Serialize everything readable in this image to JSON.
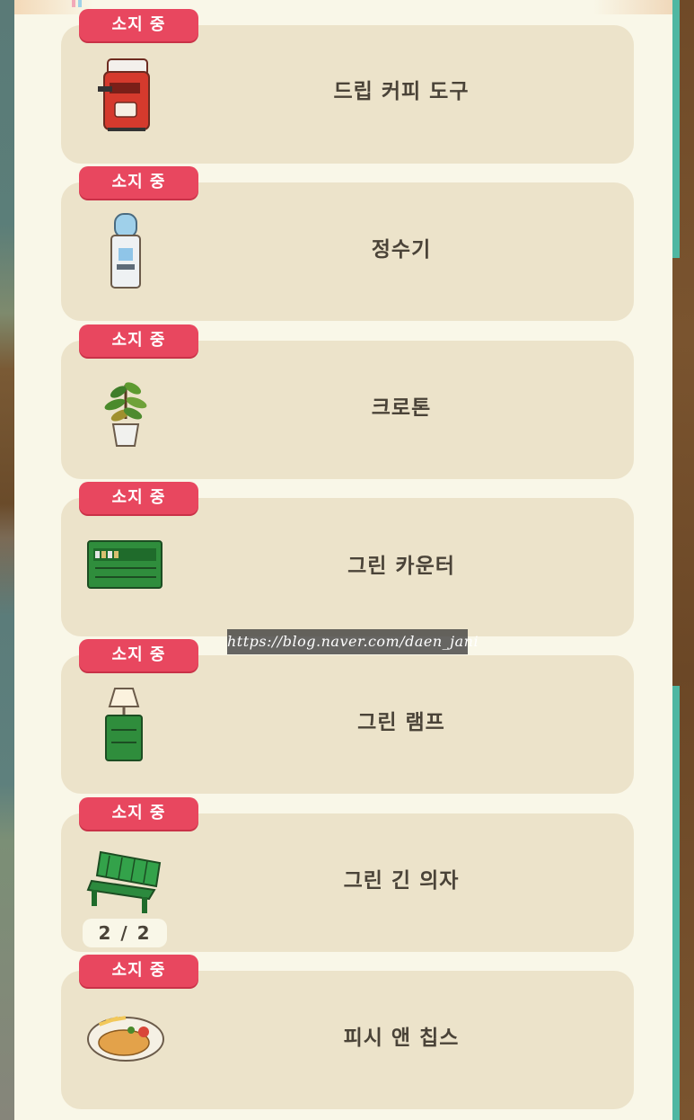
{
  "badge_label": "소지 중",
  "items": [
    {
      "name": "드립 커피 도구",
      "icon": "espresso-machine-icon"
    },
    {
      "name": "정수기",
      "icon": "water-dispenser-icon"
    },
    {
      "name": "크로톤",
      "icon": "potted-plant-icon"
    },
    {
      "name": "그린 카운터",
      "icon": "green-counter-icon"
    },
    {
      "name": "그린 램프",
      "icon": "green-lamp-icon"
    },
    {
      "name": "그린 긴 의자",
      "icon": "green-bench-icon"
    },
    {
      "name": "피시 앤 칩스",
      "icon": "fish-and-chips-icon"
    }
  ],
  "bench_count": "2 / 2",
  "watermark": "https://blog.naver.com/daen_jani",
  "colors": {
    "badge": "#e8475f",
    "card": "#ece3ca",
    "panel": "#f9f7e8",
    "text": "#4a4338",
    "scroll_accent": "#4fb7a2"
  }
}
